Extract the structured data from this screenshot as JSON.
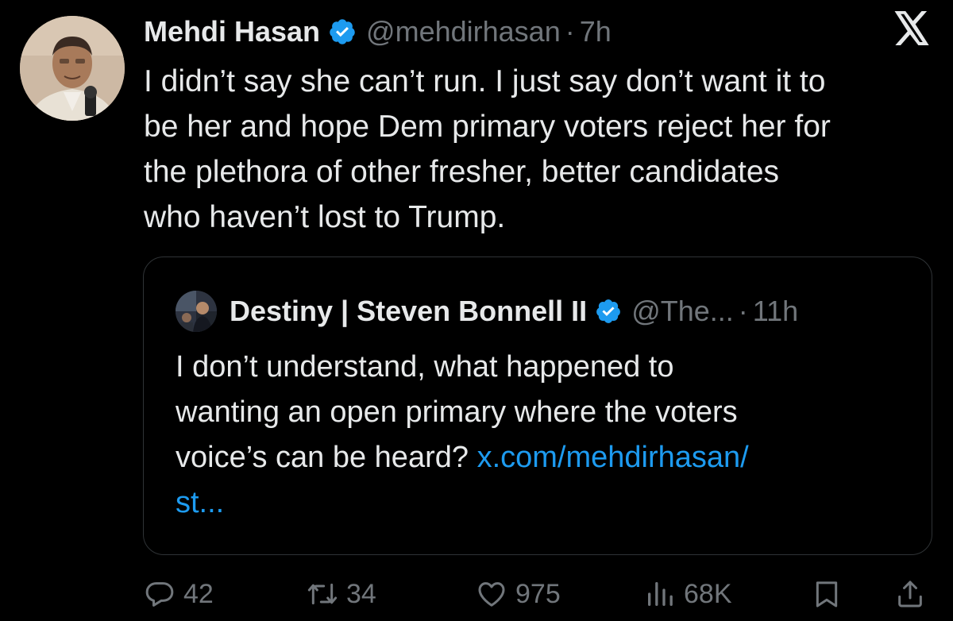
{
  "tweet": {
    "author_name": "Mehdi Hasan",
    "handle": "@mehdirhasan",
    "separator": "·",
    "time": "7h",
    "lines": [
      "I didn’t say she can’t run. I just say don’t want it to",
      "be her and hope Dem primary voters reject her for",
      "the plethora of other fresher, better candidates",
      "who haven’t lost to Trump."
    ]
  },
  "quote": {
    "author_name": "Destiny | Steven Bonnell II",
    "handle": "@The...",
    "separator": "·",
    "time": "11h",
    "lines": [
      "I don’t understand, what happened to",
      "wanting an open primary where the voters"
    ],
    "line3_text": "voice’s can be heard? ",
    "link_part1": "x.com/mehdirhasan/",
    "link_part2": "st..."
  },
  "actions": {
    "replies": "42",
    "reposts": "34",
    "likes": "975",
    "views": "68K"
  },
  "icons": {
    "verified": "verified-badge-icon",
    "logo": "x-logo-icon",
    "reply": "reply-icon",
    "repost": "repost-icon",
    "like": "heart-icon",
    "views": "views-icon",
    "bookmark": "bookmark-icon",
    "share": "share-icon"
  },
  "colors": {
    "background": "#000000",
    "text": "#e7e9ea",
    "muted": "#71767b",
    "link": "#1d9bf0",
    "verified": "#1d9bf0",
    "border": "#2f3336"
  }
}
